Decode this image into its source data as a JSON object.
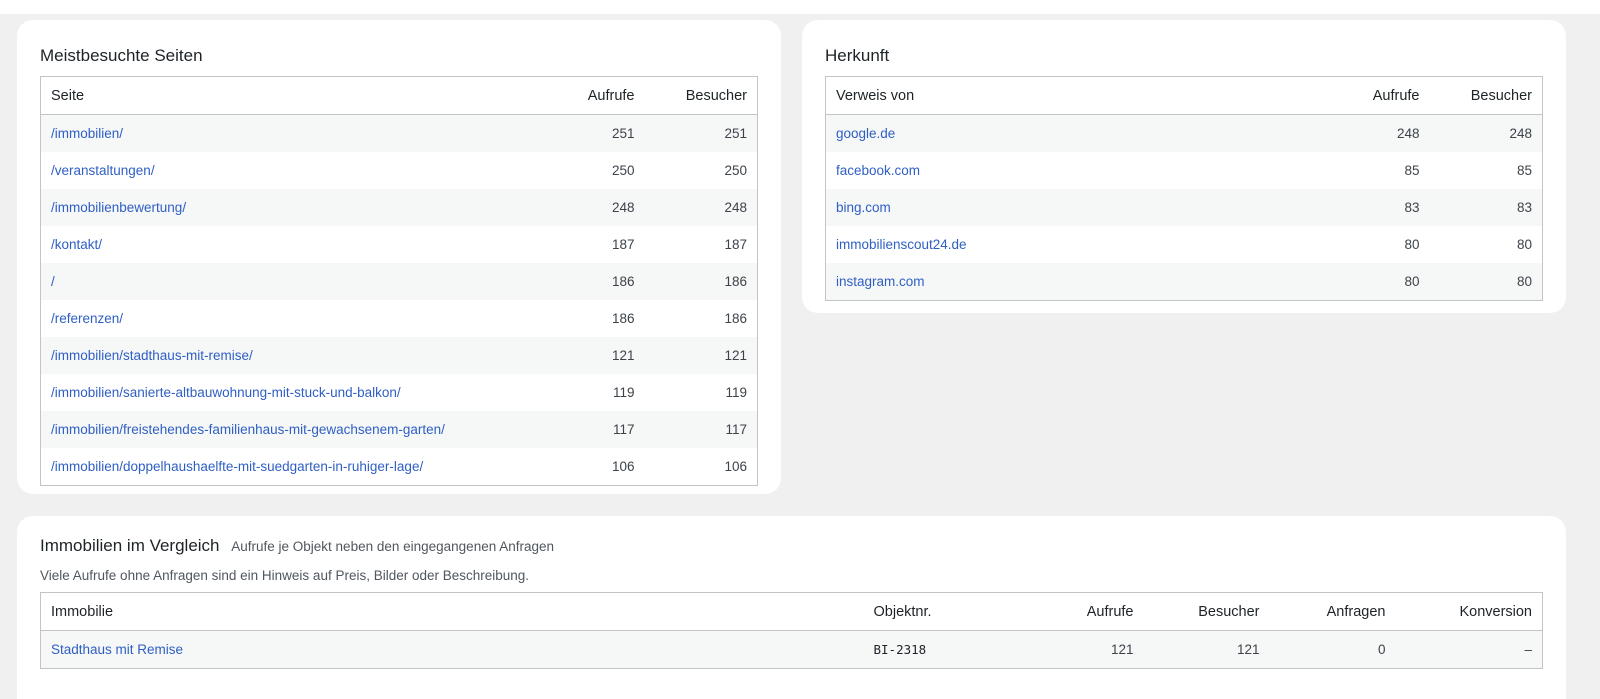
{
  "top_pages": {
    "title": "Meistbesuchte Seiten",
    "columns": [
      "Seite",
      "Aufrufe",
      "Besucher"
    ],
    "rows": [
      [
        "/immobilien/",
        "251",
        "251"
      ],
      [
        "/veranstaltungen/",
        "250",
        "250"
      ],
      [
        "/immobilienbewertung/",
        "248",
        "248"
      ],
      [
        "/kontakt/",
        "187",
        "187"
      ],
      [
        "/",
        "186",
        "186"
      ],
      [
        "/referenzen/",
        "186",
        "186"
      ],
      [
        "/immobilien/stadthaus-mit-remise/",
        "121",
        "121"
      ],
      [
        "/immobilien/sanierte-altbauwohnung-mit-stuck-und-balkon/",
        "119",
        "119"
      ],
      [
        "/immobilien/freistehendes-familienhaus-mit-gewachsenem-garten/",
        "117",
        "117"
      ],
      [
        "/immobilien/doppelhaushaelfte-mit-suedgarten-in-ruhiger-lage/",
        "106",
        "106"
      ]
    ]
  },
  "referrers": {
    "title": "Herkunft",
    "columns": [
      "Verweis von",
      "Aufrufe",
      "Besucher"
    ],
    "rows": [
      [
        "google.de",
        "248",
        "248"
      ],
      [
        "facebook.com",
        "85",
        "85"
      ],
      [
        "bing.com",
        "83",
        "83"
      ],
      [
        "immobilienscout24.de",
        "80",
        "80"
      ],
      [
        "instagram.com",
        "80",
        "80"
      ]
    ]
  },
  "comparison": {
    "title": "Immobilien im Vergleich",
    "subtitle": "Aufrufe je Objekt neben den eingegangenen Anfragen",
    "note": "Viele Aufrufe ohne Anfragen sind ein Hinweis auf Preis, Bilder oder Beschreibung.",
    "columns": [
      "Immobilie",
      "Objektnr.",
      "Aufrufe",
      "Besucher",
      "Anfragen",
      "Konversion"
    ],
    "rows": [
      [
        "Stadthaus mit Remise",
        "BI-2318",
        "121",
        "121",
        "0",
        "–"
      ]
    ]
  }
}
